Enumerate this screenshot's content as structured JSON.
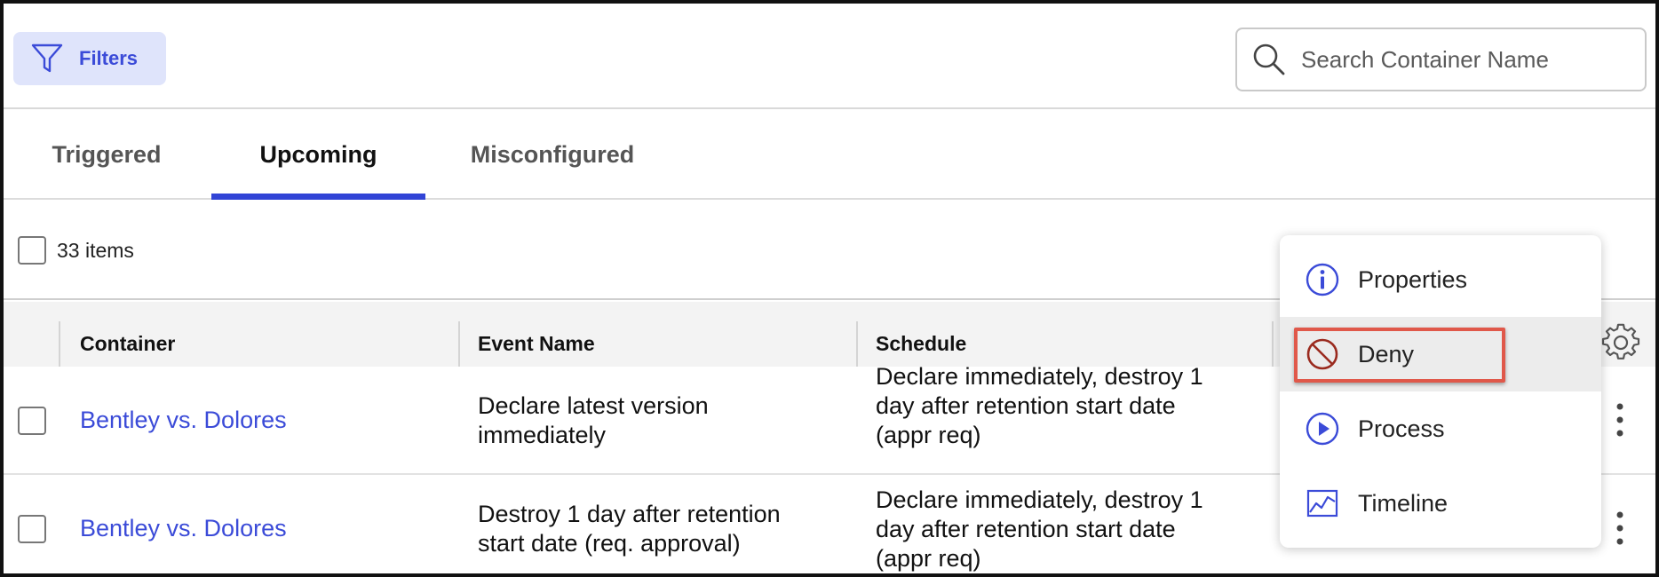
{
  "toolbar": {
    "filters_label": "Filters",
    "search_placeholder": "Search Container Name"
  },
  "tabs": [
    {
      "label": "Triggered",
      "active": false
    },
    {
      "label": "Upcoming",
      "active": true
    },
    {
      "label": "Misconfigured",
      "active": false
    }
  ],
  "list": {
    "items_count": "33 items"
  },
  "table": {
    "columns": [
      "Container",
      "Event Name",
      "Schedule"
    ],
    "rows": [
      {
        "container": "Bentley vs. Dolores",
        "event_name": [
          "Declare latest version",
          "immediately"
        ],
        "schedule": [
          "Declare immediately, destroy 1",
          "day after retention start date",
          "(appr req)"
        ]
      },
      {
        "container": "Bentley vs. Dolores",
        "event_name": [
          "Destroy 1 day after retention",
          "start date (req. approval)"
        ],
        "schedule": [
          "Declare immediately, destroy 1",
          "day after retention start date",
          "(appr req)"
        ]
      }
    ]
  },
  "context_menu": {
    "items": [
      {
        "label": "Properties",
        "icon": "info-icon"
      },
      {
        "label": "Deny",
        "icon": "deny-icon",
        "highlighted": true
      },
      {
        "label": "Process",
        "icon": "play-circle-icon"
      },
      {
        "label": "Timeline",
        "icon": "line-chart-icon"
      }
    ]
  },
  "colors": {
    "accent": "#3b4bd8",
    "tab_underline": "#3144d6",
    "filter_bg": "#dfe4fb",
    "deny_icon": "#9a2a1e",
    "highlight_border": "#e0584a"
  }
}
